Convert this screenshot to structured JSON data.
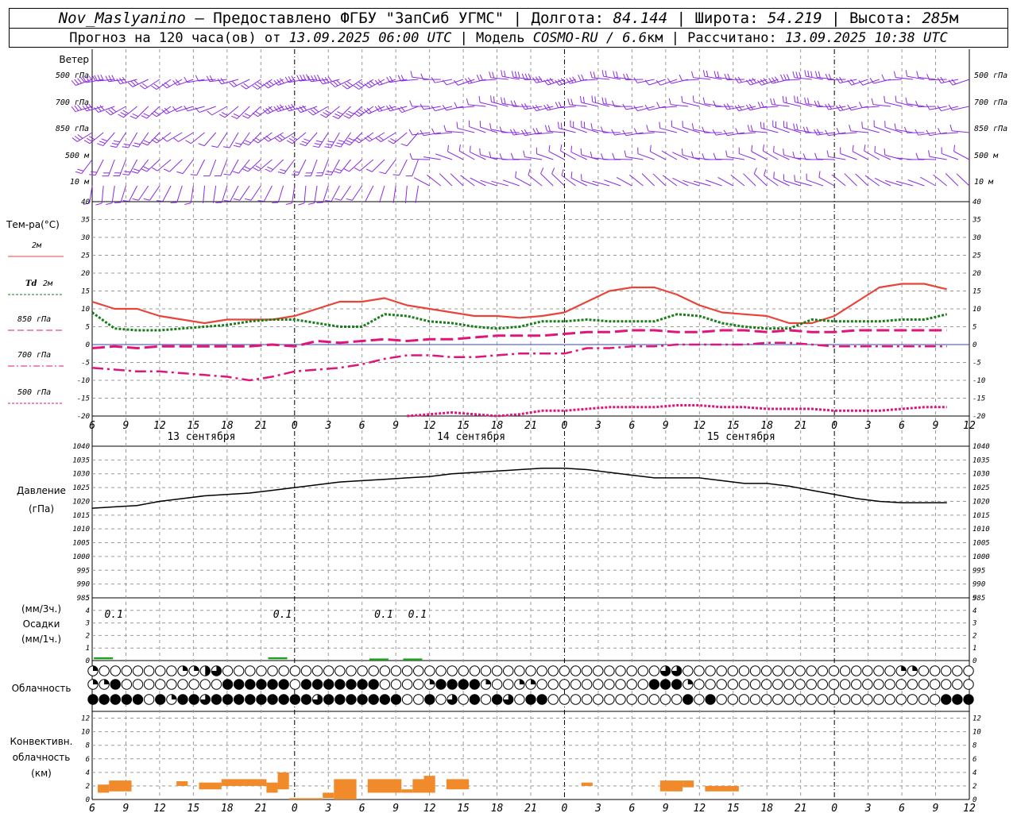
{
  "header": {
    "line1": [
      {
        "t": "Nov_Maslyanino",
        "it": true
      },
      {
        "t": " – Предоставлено ФГБУ \"ЗапСиб УГМС\" | Долгота: ",
        "it": false
      },
      {
        "t": "84.144",
        "it": true
      },
      {
        "t": " | Широта: ",
        "it": false
      },
      {
        "t": "54.219",
        "it": true
      },
      {
        "t": " | Высота: ",
        "it": false
      },
      {
        "t": "285",
        "it": true
      },
      {
        "t": "м",
        "it": false
      }
    ],
    "line2": [
      {
        "t": "Прогноз на 120 часа(ов) от ",
        "it": false
      },
      {
        "t": "13.09.2025 06:00 UTC",
        "it": true
      },
      {
        "t": " | Модель ",
        "it": false
      },
      {
        "t": "COSMO-RU / 6.6",
        "it": true
      },
      {
        "t": "км | Рассчитано: ",
        "it": false
      },
      {
        "t": "13.09.2025 10:38 UTC",
        "it": true
      }
    ]
  },
  "wind_labels": [
    "Ветер",
    "500 гПа",
    "700 гПа",
    "850 гПа",
    "500 м",
    "10 м"
  ],
  "temp_labels": {
    "title": "Тем-ра(°C)",
    "series": [
      "2м",
      "Td 2м",
      "850 гПа",
      "700 гПа",
      "500 гПа"
    ]
  },
  "pressure_labels": [
    "Давление",
    "(гПа)"
  ],
  "precip_labels": [
    "(мм/3ч.)",
    "Осадки",
    "(мм/1ч.)"
  ],
  "cloud_label": "Облачность",
  "conv_labels": [
    "Конвективн.",
    "облачность",
    "(км)"
  ],
  "x_ticks": [
    "6",
    "9",
    "12",
    "15",
    "18",
    "21",
    "0",
    "3",
    "6",
    "9",
    "12",
    "15",
    "18",
    "21",
    "0",
    "3",
    "6",
    "9",
    "12",
    "15",
    "18",
    "21",
    "0",
    "3",
    "6",
    "9",
    "12"
  ],
  "day_labels": [
    {
      "text": "13 сентября",
      "hour": 9
    },
    {
      "text": "14 сентября",
      "hour": 33
    },
    {
      "text": "15 сентября",
      "hour": 57
    }
  ],
  "colors": {
    "t2m": "#e8443a",
    "td": "#1a7d1a",
    "t850": "#e0157a",
    "t700": "#e0157a",
    "t500": "#e0157a",
    "wind": "#8a2be2",
    "pressure": "#000000",
    "precip": "#22a022",
    "conv": "#f08a2a",
    "grid": "#999999"
  },
  "chart_data": [
    {
      "type": "line",
      "name": "temperature",
      "ylim": [
        -20,
        40
      ],
      "yticks": [
        -20,
        -15,
        -10,
        -5,
        0,
        5,
        10,
        15,
        20,
        25,
        30,
        35,
        40
      ],
      "x_hours_step": [
        0,
        78,
        3
      ],
      "series": [
        {
          "name": "2м",
          "style": "solid",
          "values": [
            12,
            10,
            10,
            8,
            7,
            6,
            7,
            7,
            7,
            8,
            10,
            12,
            12,
            13,
            11,
            10,
            9,
            8,
            8,
            7.5,
            8,
            9,
            12,
            15,
            16,
            16,
            14,
            11,
            9,
            8.5,
            8,
            6,
            6,
            8,
            12,
            16,
            17,
            17,
            15.5
          ]
        },
        {
          "name": "Td 2м",
          "style": "dot",
          "values": [
            9,
            4.5,
            4,
            4,
            4.5,
            5,
            5.5,
            6.5,
            7,
            7,
            6,
            5,
            5,
            8.5,
            8,
            6.5,
            6,
            5,
            4.5,
            5,
            6.5,
            6.5,
            7,
            6.5,
            6.5,
            6.5,
            8.5,
            8,
            6,
            5,
            4.5,
            4.5,
            7,
            6.5,
            6.5,
            6.5,
            7,
            7,
            8.5
          ]
        },
        {
          "name": "850 гПа",
          "style": "dash",
          "values": [
            -1,
            -0.5,
            -1,
            -0.5,
            -0.5,
            -0.5,
            -0.5,
            -0.5,
            0,
            -0.5,
            1,
            0.5,
            1,
            1.5,
            1,
            1.5,
            1.5,
            2,
            2.5,
            2.5,
            2.5,
            3,
            3.5,
            3.5,
            4,
            4,
            3.5,
            3.5,
            4,
            4,
            3.5,
            4,
            3.5,
            3.5,
            4,
            4,
            4,
            4,
            4
          ]
        },
        {
          "name": "700 гПа",
          "style": "dashdot",
          "values": [
            -6.5,
            -7,
            -7.5,
            -7.5,
            -8,
            -8.5,
            -9,
            -10,
            -9,
            -7.5,
            -7,
            -6.5,
            -5.5,
            -4,
            -3,
            -3,
            -3.5,
            -3.5,
            -3,
            -2.5,
            -2.5,
            -2.5,
            -1,
            -1,
            -0.5,
            -0.5,
            0,
            0,
            0,
            0,
            0.5,
            0.5,
            0,
            -0.5,
            -0.5,
            -0.5,
            -0.5,
            -0.5,
            -0.5
          ]
        },
        {
          "name": "500 гПа",
          "style": "dot",
          "values": [
            null,
            null,
            null,
            null,
            null,
            null,
            null,
            null,
            null,
            null,
            null,
            null,
            null,
            null,
            -20,
            -19.5,
            -19,
            -19.5,
            -20,
            -19.5,
            -18.5,
            -18.5,
            -18,
            -17.5,
            -17.5,
            -17.5,
            -17,
            -17,
            -17.5,
            -17.5,
            -18,
            -18,
            -18,
            -18.5,
            -18.5,
            -18.5,
            -18,
            -17.5,
            -17.5
          ]
        }
      ]
    },
    {
      "type": "line",
      "name": "pressure",
      "ylim": [
        985,
        1040
      ],
      "yticks": [
        985,
        990,
        995,
        1000,
        1005,
        1010,
        1015,
        1020,
        1025,
        1030,
        1035,
        1040
      ],
      "x_hours_step": [
        0,
        78,
        3
      ],
      "series": [
        {
          "name": "Давление",
          "values": [
            1017.5,
            1018,
            1018.5,
            1020,
            1021,
            1022,
            1022.5,
            1023,
            1024,
            1025,
            1026,
            1027,
            1027.5,
            1028,
            1028.5,
            1029,
            1030,
            1030.5,
            1031,
            1031.5,
            1032,
            1032,
            1031.5,
            1030.5,
            1029.5,
            1028.5,
            1028.5,
            1028.5,
            1027.5,
            1026.5,
            1026.5,
            1025.5,
            1024,
            1022.5,
            1021,
            1020,
            1019.5,
            1019.5,
            1019.5
          ]
        }
      ]
    },
    {
      "type": "bar",
      "name": "precipitation",
      "ylim": [
        0,
        5
      ],
      "yticks": [
        0,
        1,
        2,
        3,
        4,
        5
      ],
      "bars": [
        {
          "hour": 1,
          "value": 0.1
        },
        {
          "hour": 16.5,
          "value": 0.1
        },
        {
          "hour": 25.5,
          "value": 0.05
        },
        {
          "hour": 28.5,
          "value": 0.05
        }
      ],
      "labels": [
        {
          "hour": 1.5,
          "text": "0.1"
        },
        {
          "hour": 16.5,
          "text": "0.1"
        },
        {
          "hour": 25.5,
          "text": "0.1"
        },
        {
          "hour": 28.5,
          "text": "0.1"
        }
      ]
    },
    {
      "type": "bar",
      "name": "convective",
      "ylim": [
        0,
        13
      ],
      "yticks": [
        0,
        2,
        4,
        6,
        8,
        10,
        12
      ],
      "bars": [
        {
          "h0": 0.5,
          "h1": 1.5,
          "bot": 1,
          "top": 2.2
        },
        {
          "h0": 1.5,
          "h1": 3.5,
          "bot": 1.2,
          "top": 2.8
        },
        {
          "h0": 7.5,
          "h1": 8.5,
          "bot": 2,
          "top": 2.7
        },
        {
          "h0": 9.5,
          "h1": 11.5,
          "bot": 1.5,
          "top": 2.5
        },
        {
          "h0": 11.5,
          "h1": 13.5,
          "bot": 2,
          "top": 3
        },
        {
          "h0": 13.5,
          "h1": 15.5,
          "bot": 2,
          "top": 3
        },
        {
          "h0": 15.5,
          "h1": 16.5,
          "bot": 1,
          "top": 2.5
        },
        {
          "h0": 16.5,
          "h1": 17.5,
          "bot": 1.5,
          "top": 4
        },
        {
          "h0": 17.5,
          "h1": 20.5,
          "bot": 0,
          "top": 0.2
        },
        {
          "h0": 20.5,
          "h1": 21.5,
          "bot": 0.2,
          "top": 1
        },
        {
          "h0": 21.5,
          "h1": 23.5,
          "bot": 0,
          "top": 3
        },
        {
          "h0": 24.5,
          "h1": 27.5,
          "bot": 1,
          "top": 3
        },
        {
          "h0": 27.5,
          "h1": 28.5,
          "bot": 1,
          "top": 1.5
        },
        {
          "h0": 28.5,
          "h1": 29.5,
          "bot": 1,
          "top": 3
        },
        {
          "h0": 29.5,
          "h1": 30.5,
          "bot": 1,
          "top": 3.5
        },
        {
          "h0": 31.5,
          "h1": 33.5,
          "bot": 1.5,
          "top": 3
        },
        {
          "h0": 43.5,
          "h1": 44.5,
          "bot": 2,
          "top": 2.5
        },
        {
          "h0": 50.5,
          "h1": 52.5,
          "bot": 1.2,
          "top": 2.8
        },
        {
          "h0": 52.5,
          "h1": 53.5,
          "bot": 1.8,
          "top": 2.8
        },
        {
          "h0": 54.5,
          "h1": 57.5,
          "bot": 1.2,
          "top": 2
        }
      ]
    },
    {
      "type": "scatter",
      "name": "wind",
      "levels": [
        "500 гПа",
        "700 гПа",
        "850 гПа",
        "500 м",
        "10 м"
      ],
      "x_hours_step": [
        0,
        78,
        1
      ]
    }
  ],
  "clouds": {
    "rows": 3,
    "count": 79,
    "codes": [
      "5000000055670000000000000000000000000000000000000007700000000000000000005500000",
      "5580000000008888880888888800005888850055000000000088850000000000000000000000000",
      "8888808588788888888878888888008070808708800000000000080800000000000000000000888"
    ]
  }
}
